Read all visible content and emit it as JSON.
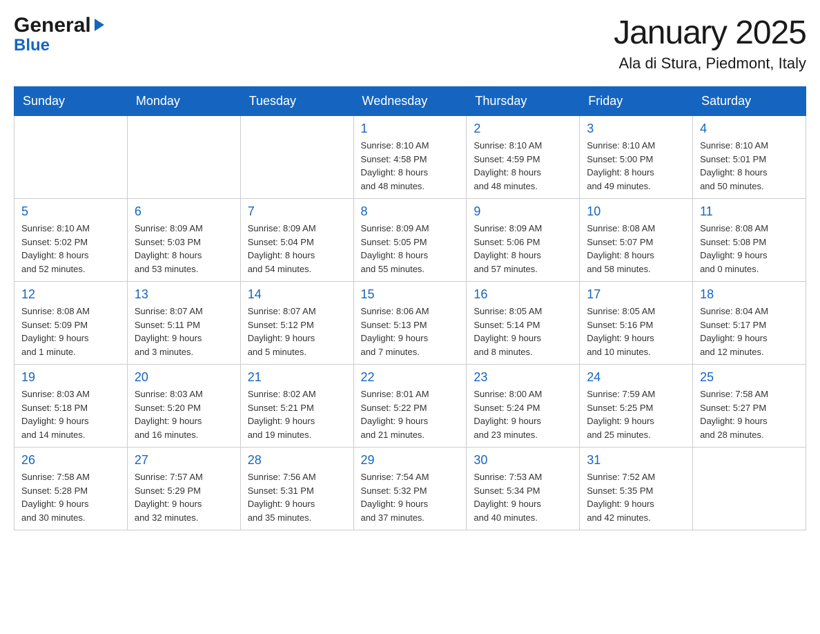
{
  "logo": {
    "general": "General",
    "blue": "Blue"
  },
  "title": "January 2025",
  "location": "Ala di Stura, Piedmont, Italy",
  "days_of_week": [
    "Sunday",
    "Monday",
    "Tuesday",
    "Wednesday",
    "Thursday",
    "Friday",
    "Saturday"
  ],
  "weeks": [
    [
      {
        "day": "",
        "info": ""
      },
      {
        "day": "",
        "info": ""
      },
      {
        "day": "",
        "info": ""
      },
      {
        "day": "1",
        "info": "Sunrise: 8:10 AM\nSunset: 4:58 PM\nDaylight: 8 hours\nand 48 minutes."
      },
      {
        "day": "2",
        "info": "Sunrise: 8:10 AM\nSunset: 4:59 PM\nDaylight: 8 hours\nand 48 minutes."
      },
      {
        "day": "3",
        "info": "Sunrise: 8:10 AM\nSunset: 5:00 PM\nDaylight: 8 hours\nand 49 minutes."
      },
      {
        "day": "4",
        "info": "Sunrise: 8:10 AM\nSunset: 5:01 PM\nDaylight: 8 hours\nand 50 minutes."
      }
    ],
    [
      {
        "day": "5",
        "info": "Sunrise: 8:10 AM\nSunset: 5:02 PM\nDaylight: 8 hours\nand 52 minutes."
      },
      {
        "day": "6",
        "info": "Sunrise: 8:09 AM\nSunset: 5:03 PM\nDaylight: 8 hours\nand 53 minutes."
      },
      {
        "day": "7",
        "info": "Sunrise: 8:09 AM\nSunset: 5:04 PM\nDaylight: 8 hours\nand 54 minutes."
      },
      {
        "day": "8",
        "info": "Sunrise: 8:09 AM\nSunset: 5:05 PM\nDaylight: 8 hours\nand 55 minutes."
      },
      {
        "day": "9",
        "info": "Sunrise: 8:09 AM\nSunset: 5:06 PM\nDaylight: 8 hours\nand 57 minutes."
      },
      {
        "day": "10",
        "info": "Sunrise: 8:08 AM\nSunset: 5:07 PM\nDaylight: 8 hours\nand 58 minutes."
      },
      {
        "day": "11",
        "info": "Sunrise: 8:08 AM\nSunset: 5:08 PM\nDaylight: 9 hours\nand 0 minutes."
      }
    ],
    [
      {
        "day": "12",
        "info": "Sunrise: 8:08 AM\nSunset: 5:09 PM\nDaylight: 9 hours\nand 1 minute."
      },
      {
        "day": "13",
        "info": "Sunrise: 8:07 AM\nSunset: 5:11 PM\nDaylight: 9 hours\nand 3 minutes."
      },
      {
        "day": "14",
        "info": "Sunrise: 8:07 AM\nSunset: 5:12 PM\nDaylight: 9 hours\nand 5 minutes."
      },
      {
        "day": "15",
        "info": "Sunrise: 8:06 AM\nSunset: 5:13 PM\nDaylight: 9 hours\nand 7 minutes."
      },
      {
        "day": "16",
        "info": "Sunrise: 8:05 AM\nSunset: 5:14 PM\nDaylight: 9 hours\nand 8 minutes."
      },
      {
        "day": "17",
        "info": "Sunrise: 8:05 AM\nSunset: 5:16 PM\nDaylight: 9 hours\nand 10 minutes."
      },
      {
        "day": "18",
        "info": "Sunrise: 8:04 AM\nSunset: 5:17 PM\nDaylight: 9 hours\nand 12 minutes."
      }
    ],
    [
      {
        "day": "19",
        "info": "Sunrise: 8:03 AM\nSunset: 5:18 PM\nDaylight: 9 hours\nand 14 minutes."
      },
      {
        "day": "20",
        "info": "Sunrise: 8:03 AM\nSunset: 5:20 PM\nDaylight: 9 hours\nand 16 minutes."
      },
      {
        "day": "21",
        "info": "Sunrise: 8:02 AM\nSunset: 5:21 PM\nDaylight: 9 hours\nand 19 minutes."
      },
      {
        "day": "22",
        "info": "Sunrise: 8:01 AM\nSunset: 5:22 PM\nDaylight: 9 hours\nand 21 minutes."
      },
      {
        "day": "23",
        "info": "Sunrise: 8:00 AM\nSunset: 5:24 PM\nDaylight: 9 hours\nand 23 minutes."
      },
      {
        "day": "24",
        "info": "Sunrise: 7:59 AM\nSunset: 5:25 PM\nDaylight: 9 hours\nand 25 minutes."
      },
      {
        "day": "25",
        "info": "Sunrise: 7:58 AM\nSunset: 5:27 PM\nDaylight: 9 hours\nand 28 minutes."
      }
    ],
    [
      {
        "day": "26",
        "info": "Sunrise: 7:58 AM\nSunset: 5:28 PM\nDaylight: 9 hours\nand 30 minutes."
      },
      {
        "day": "27",
        "info": "Sunrise: 7:57 AM\nSunset: 5:29 PM\nDaylight: 9 hours\nand 32 minutes."
      },
      {
        "day": "28",
        "info": "Sunrise: 7:56 AM\nSunset: 5:31 PM\nDaylight: 9 hours\nand 35 minutes."
      },
      {
        "day": "29",
        "info": "Sunrise: 7:54 AM\nSunset: 5:32 PM\nDaylight: 9 hours\nand 37 minutes."
      },
      {
        "day": "30",
        "info": "Sunrise: 7:53 AM\nSunset: 5:34 PM\nDaylight: 9 hours\nand 40 minutes."
      },
      {
        "day": "31",
        "info": "Sunrise: 7:52 AM\nSunset: 5:35 PM\nDaylight: 9 hours\nand 42 minutes."
      },
      {
        "day": "",
        "info": ""
      }
    ]
  ]
}
